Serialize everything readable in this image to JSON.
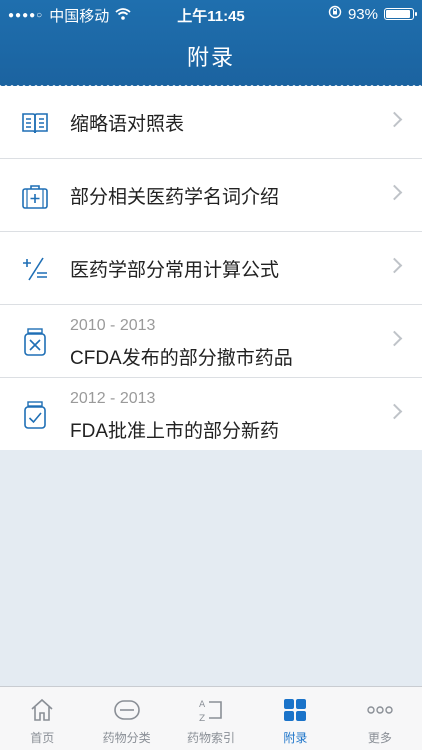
{
  "status_bar": {
    "carrier": "中国移动",
    "time": "上午11:45",
    "battery": "93%",
    "battery_level": 0.93
  },
  "header": {
    "title": "附录"
  },
  "list": {
    "items": [
      {
        "icon": "book-icon",
        "label": "缩略语对照表"
      },
      {
        "icon": "medical-kit-icon",
        "label": "部分相关医药学名词介绍"
      },
      {
        "icon": "calculator-icon",
        "label": "医药学部分常用计算公式"
      },
      {
        "icon": "withdrawn-drug-icon",
        "sub": "2010 - 2013",
        "label": "CFDA发布的部分撤市药品"
      },
      {
        "icon": "approved-drug-icon",
        "sub": "2012 - 2013",
        "label": "FDA批准上市的部分新药"
      }
    ]
  },
  "tabbar": {
    "items": [
      {
        "icon": "home-icon",
        "label": "首页"
      },
      {
        "icon": "pill-icon",
        "label": "药物分类"
      },
      {
        "icon": "az-index-icon",
        "label": "药物索引"
      },
      {
        "icon": "grid-icon",
        "label": "附录",
        "active": true
      },
      {
        "icon": "more-icon",
        "label": "更多"
      }
    ]
  },
  "colors": {
    "header": "#1b63a0",
    "accent": "#1a73c9",
    "background": "#e4ebf2"
  }
}
